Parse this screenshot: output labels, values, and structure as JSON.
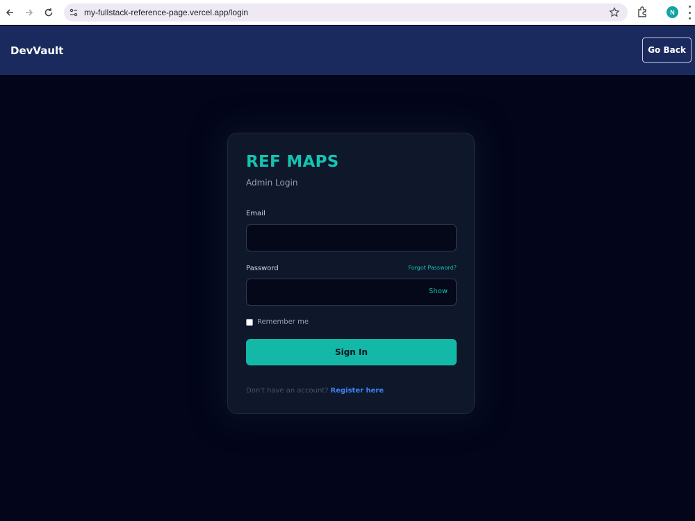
{
  "browser": {
    "url": "my-fullstack-reference-page.vercel.app/login",
    "profile_initial": "N",
    "icons": [
      "back-arrow-icon",
      "forward-arrow-icon",
      "reload-icon",
      "site-info-icon",
      "star-icon",
      "extensions-icon",
      "kebab-menu-icon"
    ]
  },
  "header": {
    "brand": "DevVault",
    "go_back_label": "Go Back",
    "background": "#1b2a5e"
  },
  "login": {
    "title": "REF MAPS",
    "subtitle": "Admin Login",
    "email_label": "Email",
    "email_value": "",
    "password_label": "Password",
    "password_value": "",
    "forgot_label": "Forgot Password?",
    "show_label": "Show",
    "remember_label": "Remember me",
    "remember_checked": false,
    "signin_label": "Sign In",
    "footer_text": "Don't have an account?",
    "register_label": "Register here"
  },
  "colors": {
    "accent": "#14b8a6",
    "link": "#3b82f6",
    "page_bg": "#03061a",
    "card_bg": "#0f172a"
  }
}
